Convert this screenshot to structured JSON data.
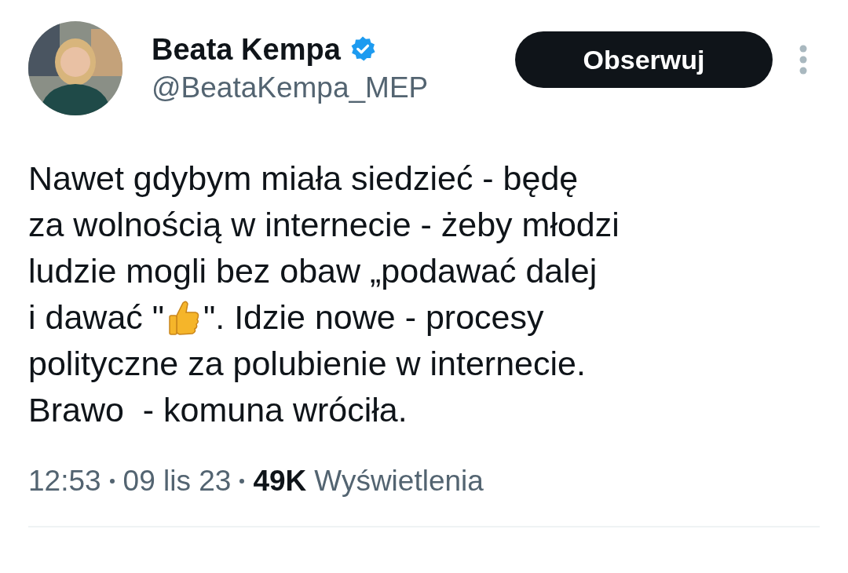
{
  "author": {
    "name": "Beata Kempa",
    "verified": true,
    "handle": "@BeataKempa_MEP"
  },
  "follow_button": {
    "label": "Obserwuj"
  },
  "tweet_lines": [
    {
      "parts": [
        {
          "kind": "text",
          "text": "Nawet gdybym miała siedzieć - będę"
        }
      ]
    },
    {
      "parts": [
        {
          "kind": "text",
          "text": "za wolnością w internecie - żeby młodzi"
        }
      ]
    },
    {
      "parts": [
        {
          "kind": "text",
          "text": "ludzie mogli bez obaw „podawać dalej"
        }
      ]
    },
    {
      "parts": [
        {
          "kind": "text",
          "text": "i dawać \""
        },
        {
          "kind": "thumbs_up"
        },
        {
          "kind": "text",
          "text": "\". Idzie nowe - procesy"
        }
      ]
    },
    {
      "parts": [
        {
          "kind": "text",
          "text": "polityczne za polubienie w internecie."
        }
      ]
    },
    {
      "parts": [
        {
          "kind": "text",
          "text": "Brawo  - komuna wróciła."
        }
      ]
    }
  ],
  "meta": {
    "time": "12:53",
    "date": "09 lis 23",
    "views_count": "49K",
    "views_label": "Wyświetlenia"
  }
}
